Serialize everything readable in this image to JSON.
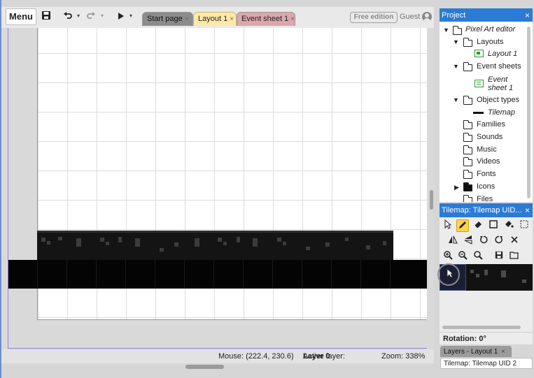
{
  "toolbar": {
    "menu_label": "Menu",
    "save_icon": "save-icon",
    "undo_icon": "undo-icon",
    "redo_icon": "redo-icon",
    "play_icon": "play-icon",
    "free_edition_label": "Free edition",
    "user_label": "Guest"
  },
  "tabs": [
    {
      "label": "Start page",
      "close": "×",
      "active": false
    },
    {
      "label": "Layout 1",
      "close": "×",
      "active": true
    },
    {
      "label": "Event sheet 1",
      "close": "×",
      "active": false
    }
  ],
  "statusbar": {
    "mouse": "Mouse: (222.4, 230.6)",
    "active_layer_prefix": "Active layer: ",
    "active_layer": "Layer 0",
    "zoom": "Zoom: 338%"
  },
  "project_panel": {
    "title": "Project",
    "close": "×",
    "tree": {
      "root": "Pixel Art editor",
      "layouts": "Layouts",
      "layout_1": "Layout 1",
      "event_sheets": "Event sheets",
      "event_sheet_1_line1": "Event",
      "event_sheet_1_line2": "sheet 1",
      "object_types": "Object types",
      "tilemap": "Tilemap",
      "families": "Families",
      "sounds": "Sounds",
      "music": "Music",
      "videos": "Videos",
      "fonts": "Fonts",
      "icons": "Icons",
      "files": "Files"
    }
  },
  "tilemap_panel": {
    "title": "Tilemap: Tilemap UID...",
    "close": "×",
    "rotation_label": "Rotation: 0°"
  },
  "bottom_tabs": {
    "layers": "Layers - Layout 1",
    "layers_close": "×",
    "tilemap": "Tilemap: Tilemap UID 2"
  },
  "colors": {
    "panel_header": "#2b7bd6",
    "active_tab": "#ffe9a8",
    "event_tab": "#dba6ad",
    "active_tool": "#ffd54a"
  }
}
